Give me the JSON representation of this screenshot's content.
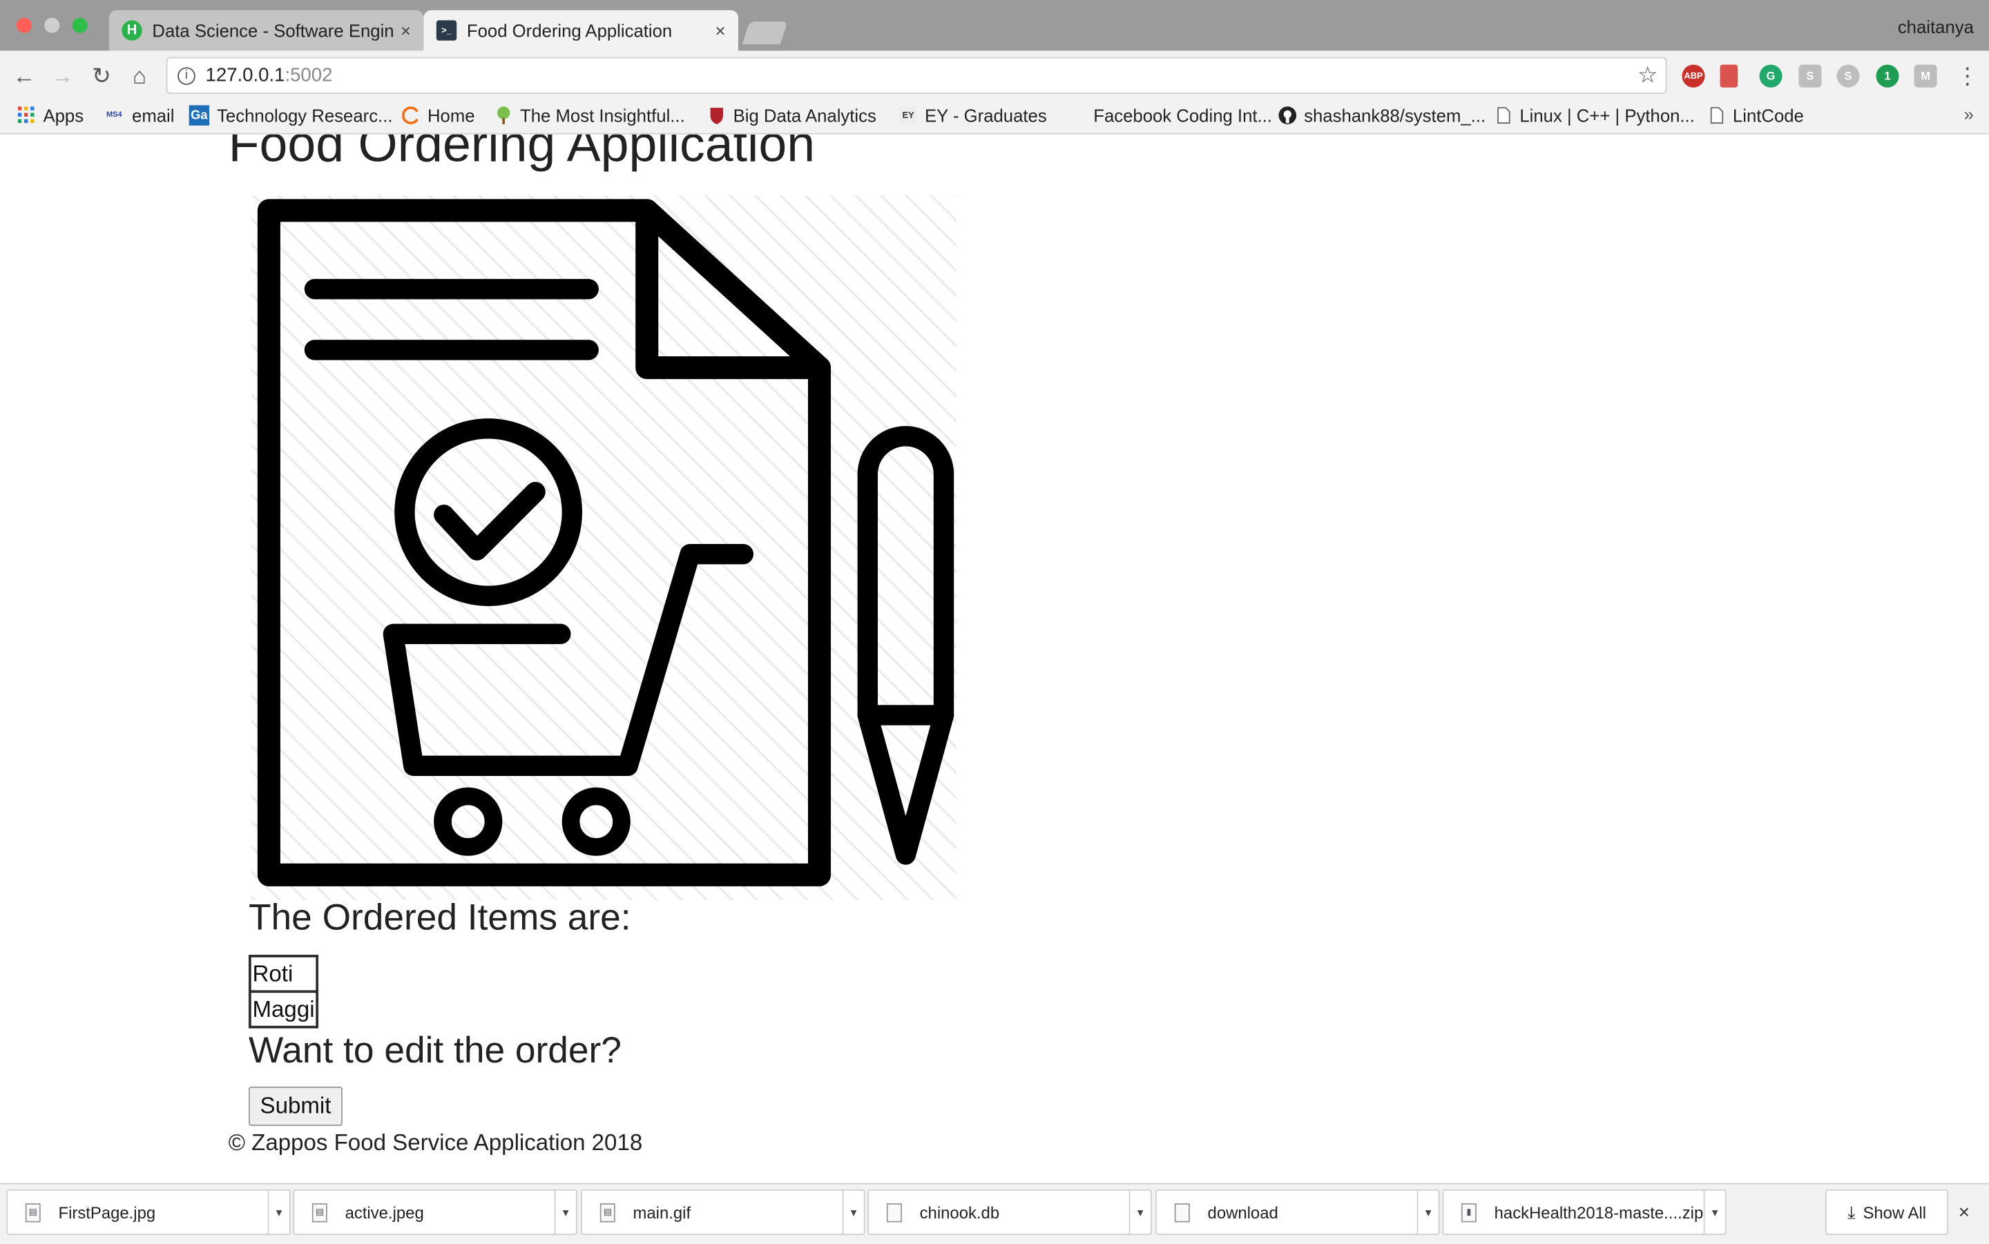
{
  "browser": {
    "tabs": [
      {
        "title": "Data Science - Software Engin",
        "favicon": "H",
        "favicon_color": "#2bb24c",
        "close": "×"
      },
      {
        "title": "Food Ordering Application",
        "favicon": ">_",
        "favicon_color": "#2b3a4a",
        "close": "×"
      }
    ],
    "profile": "chaitanya",
    "url_host": "127.0.0.1",
    "url_port": ":5002",
    "info_icon": "i",
    "star_icon": "☆",
    "back_icon": "←",
    "forward_icon": "→",
    "reload_icon": "↻",
    "home_icon": "⌂",
    "menu_icon": "⋮",
    "extensions": [
      {
        "name": "adblock-icon",
        "label": "ABP",
        "color": "#c9302c"
      },
      {
        "name": "bookmark-ext-icon",
        "label": "",
        "color": "#d9534f"
      },
      {
        "name": "grammarly-icon",
        "label": "G",
        "color": "#22a86b"
      },
      {
        "name": "ext-s-icon",
        "label": "S",
        "color": "#bdbdbd"
      },
      {
        "name": "skype-icon",
        "label": "S",
        "color": "#bdbdbd"
      },
      {
        "name": "ext-badge-icon",
        "label": "1",
        "color": "#1f9d55"
      },
      {
        "name": "ext-m-icon",
        "label": "M",
        "color": "#bdbdbd"
      }
    ]
  },
  "bookmarks": {
    "items": [
      {
        "label": "Apps",
        "icon": "apps-grid-icon"
      },
      {
        "label": "email",
        "icon": "ms-icon"
      },
      {
        "label": "Technology Researc...",
        "icon": "ga-icon"
      },
      {
        "label": "Home",
        "icon": "home-c-icon"
      },
      {
        "label": "The Most Insightful...",
        "icon": "tree-icon"
      },
      {
        "label": "Big Data Analytics",
        "icon": "shield-icon"
      },
      {
        "label": "EY - Graduates",
        "icon": "ey-icon"
      },
      {
        "label": "Facebook Coding Int...",
        "icon": "none"
      },
      {
        "label": "shashank88/system_...",
        "icon": "github-icon"
      },
      {
        "label": "Linux | C++ | Python...",
        "icon": "page-icon"
      },
      {
        "label": "LintCode",
        "icon": "page-icon"
      }
    ],
    "more": "»"
  },
  "page": {
    "title": "Food Ordering Application",
    "ordered_heading": "The Ordered Items are:",
    "items": [
      "Roti",
      "Maggi"
    ],
    "edit_heading": "Want to edit the order?",
    "submit_label": "Submit",
    "footer": "© Zappos Food Service Application 2018"
  },
  "downloads": {
    "files": [
      "FirstPage.jpg",
      "active.jpeg",
      "main.gif",
      "chinook.db",
      "download",
      "hackHealth2018-maste....zip"
    ],
    "show_all": "Show All",
    "close": "×"
  }
}
